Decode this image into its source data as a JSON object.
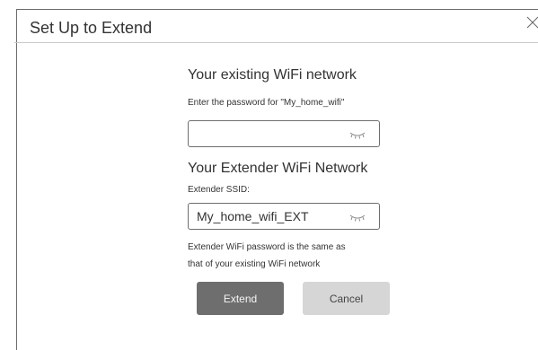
{
  "dialog": {
    "title": "Set Up to Extend",
    "close_icon": "close-icon"
  },
  "existing": {
    "heading": "Your existing WiFi network",
    "prompt": "Enter the password for \"My_home_wifi\"",
    "password_value": "",
    "eye_icon": "eye-closed-icon"
  },
  "extender": {
    "heading": "Your Extender WiFi Network",
    "ssid_label": "Extender SSID:",
    "ssid_value": "My_home_wifi_EXT",
    "eye_icon": "eye-closed-icon",
    "note_line1": "Extender WiFi password is the same as",
    "note_line2": "that of your existing WiFi network"
  },
  "actions": {
    "extend_label": "Extend",
    "cancel_label": "Cancel"
  },
  "colors": {
    "primary_button": "#6e6e6e",
    "secondary_button": "#d6d6d6"
  }
}
